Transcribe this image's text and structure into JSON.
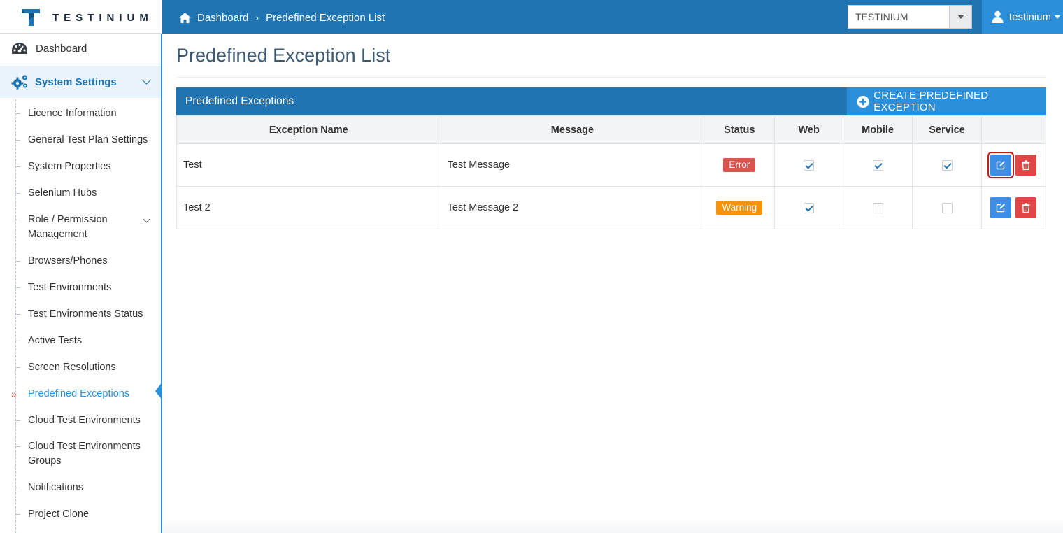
{
  "brand": {
    "name": "TESTINIUM"
  },
  "header": {
    "breadcrumb": [
      "Dashboard",
      "Predefined Exception List"
    ],
    "project_select": {
      "value": "TESTINIUM"
    },
    "user": {
      "name": "testinium"
    }
  },
  "sidebar": {
    "dashboard_label": "Dashboard",
    "section_label": "System Settings",
    "items": [
      {
        "label": "Licence Information"
      },
      {
        "label": "General Test Plan Settings"
      },
      {
        "label": "System Properties"
      },
      {
        "label": "Selenium Hubs"
      },
      {
        "label": "Role / Permission Management"
      },
      {
        "label": "Browsers/Phones"
      },
      {
        "label": "Test Environments"
      },
      {
        "label": "Test Environments Status"
      },
      {
        "label": "Active Tests"
      },
      {
        "label": "Screen Resolutions"
      },
      {
        "label": "Predefined Exceptions"
      },
      {
        "label": "Cloud Test Environments"
      },
      {
        "label": "Cloud Test Environments Groups"
      },
      {
        "label": "Notifications"
      },
      {
        "label": "Project Clone"
      }
    ],
    "active_item": "Predefined Exceptions"
  },
  "main": {
    "page_title": "Predefined Exception List",
    "panel_title": "Predefined Exceptions",
    "create_button_label": "CREATE PREDEFINED EXCEPTION",
    "table": {
      "columns": [
        "Exception Name",
        "Message",
        "Status",
        "Web",
        "Mobile",
        "Service",
        ""
      ],
      "rows": [
        {
          "name": "Test",
          "message": "Test Message",
          "status": "Error",
          "web": true,
          "mobile": true,
          "service": true
        },
        {
          "name": "Test 2",
          "message": "Test Message 2",
          "status": "Warning",
          "web": true,
          "mobile": false,
          "service": false
        }
      ]
    }
  },
  "colors": {
    "header_blue": "#1f74b1",
    "accent_blue": "#2b8fd9",
    "error": "#d9534f",
    "warning": "#f5930b",
    "delete": "#e04646"
  }
}
